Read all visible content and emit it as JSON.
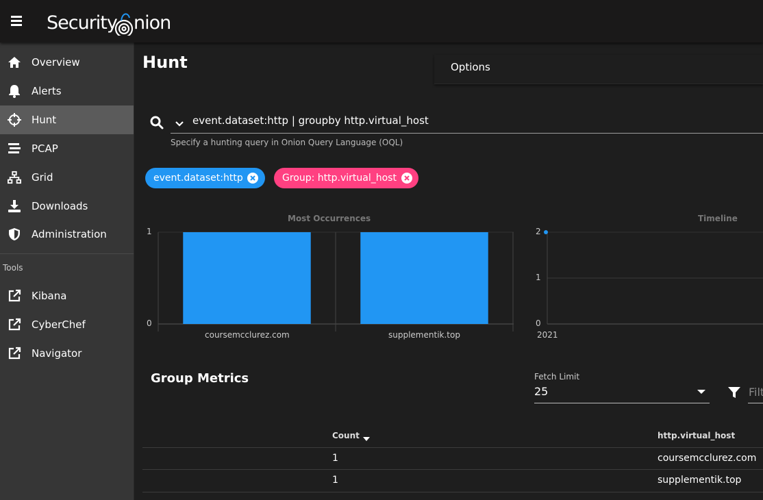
{
  "header": {
    "brand": "Security Onion"
  },
  "sidebar": {
    "items": [
      {
        "label": "Overview",
        "icon": "home-icon"
      },
      {
        "label": "Alerts",
        "icon": "bell-icon"
      },
      {
        "label": "Hunt",
        "icon": "crosshairs-icon",
        "active": true
      },
      {
        "label": "PCAP",
        "icon": "stream-icon"
      },
      {
        "label": "Grid",
        "icon": "network-icon"
      },
      {
        "label": "Downloads",
        "icon": "download-icon"
      },
      {
        "label": "Administration",
        "icon": "shield-icon"
      }
    ],
    "tools_header": "Tools",
    "tools": [
      {
        "label": "Kibana",
        "icon": "external-link-icon"
      },
      {
        "label": "CyberChef",
        "icon": "external-link-icon"
      },
      {
        "label": "Navigator",
        "icon": "external-link-icon"
      }
    ]
  },
  "main": {
    "title": "Hunt",
    "options_label": "Options",
    "query": "event.dataset:http | groupby http.virtual_host",
    "query_hint": "Specify a hunting query in Onion Query Language (OQL)",
    "chips": [
      {
        "label": "event.dataset:http",
        "color": "#2196f3"
      },
      {
        "label": "Group: http.virtual_host",
        "color": "#ff4081"
      }
    ]
  },
  "chart_data": [
    {
      "type": "bar",
      "title": "Most Occurrences",
      "categories": [
        "coursemcclurez.com",
        "supplementik.top"
      ],
      "values": [
        1,
        1
      ],
      "ylim": [
        0,
        1
      ],
      "yticks": [
        "1",
        "0"
      ],
      "color": "#2196f3"
    },
    {
      "type": "line",
      "title": "Timeline",
      "x": [
        "2021"
      ],
      "values": [
        2
      ],
      "ylim": [
        0,
        2
      ],
      "yticks": [
        "2",
        "1",
        "0"
      ],
      "color": "#2196f3"
    }
  ],
  "metrics": {
    "title": "Group Metrics",
    "fetch_limit_label": "Fetch Limit",
    "fetch_limit_value": "25",
    "filter_placeholder": "Filt",
    "columns": [
      "Count",
      "http.virtual_host"
    ],
    "rows": [
      {
        "count": "1",
        "host": "coursemcclurez.com"
      },
      {
        "count": "1",
        "host": "supplementik.top"
      }
    ]
  }
}
